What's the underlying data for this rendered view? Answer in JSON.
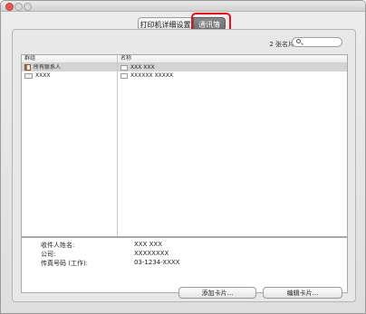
{
  "tabs": {
    "printer_settings": "打印机详细设置",
    "address_book": "通讯簿"
  },
  "toolbar": {
    "card_count": "2 张名片",
    "search_placeholder": ""
  },
  "columns": {
    "group": "群组",
    "name": "名称"
  },
  "groups": [
    {
      "label": "所有联系人",
      "icon": "address-book-icon"
    },
    {
      "label": "XXXX",
      "icon": "group-icon"
    }
  ],
  "names": [
    {
      "label": "XXX XXX",
      "icon": "card-icon"
    },
    {
      "label": "XXXXXX XXXXX",
      "icon": "card-icon"
    }
  ],
  "details": {
    "recipient_label": "收件人姓名:",
    "recipient_value": "XXX XXX",
    "company_label": "公司:",
    "company_value": "XXXXXXXX",
    "fax_label": "传真号码 (工作):",
    "fax_value": "03-1234-XXXX"
  },
  "buttons": {
    "add": "添加卡片...",
    "edit": "编辑卡片..."
  },
  "colors": {
    "highlight": "#e4121c",
    "selection": "#d4d4d4"
  }
}
